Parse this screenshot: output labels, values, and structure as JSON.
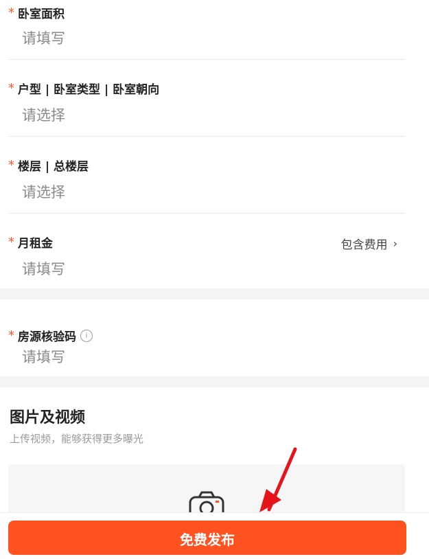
{
  "form": {
    "fields": [
      {
        "label": "卧室面积",
        "value": "请填写"
      },
      {
        "label": "户型 | 卧室类型 | 卧室朝向",
        "value": "请选择"
      },
      {
        "label": "楼层 | 总楼层",
        "value": "请选择"
      },
      {
        "label": "月租金",
        "value": "请填写",
        "right_link": "包含费用"
      },
      {
        "label": "房源核验码",
        "value": "请填写",
        "info": "i"
      }
    ],
    "required_mark": "*"
  },
  "media": {
    "title": "图片及视频",
    "subtitle": "上传视频，能够获得更多曝光"
  },
  "actions": {
    "publish_label": "免费发布"
  },
  "colors": {
    "accent": "#ff5220",
    "placeholder": "#8a8a8a",
    "arrow": "#e5141b"
  },
  "icons": {
    "chevron": "chevron-right-icon",
    "info": "info-icon",
    "camera": "camera-icon",
    "arrow": "red-arrow-annotation"
  }
}
